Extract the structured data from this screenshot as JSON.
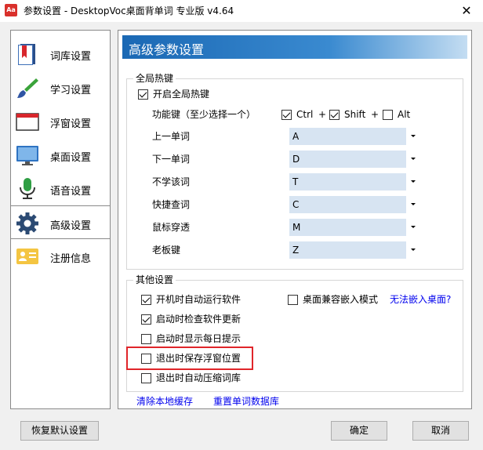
{
  "window": {
    "app_icon_text": "Aa",
    "title": "参数设置 - DesktopVoc桌面背单词 专业版 v4.64",
    "close_glyph": "✕"
  },
  "sidebar": {
    "items": [
      {
        "label": "词库设置",
        "icon": "book-icon"
      },
      {
        "label": "学习设置",
        "icon": "brush-icon"
      },
      {
        "label": "浮窗设置",
        "icon": "window-icon"
      },
      {
        "label": "桌面设置",
        "icon": "monitor-icon"
      },
      {
        "label": "语音设置",
        "icon": "microphone-icon"
      },
      {
        "label": "高级设置",
        "icon": "gear-icon"
      },
      {
        "label": "注册信息",
        "icon": "id-card-icon"
      }
    ],
    "active": "高级设置"
  },
  "main": {
    "title": "高级参数设置",
    "hotkeys": {
      "group_title": "全局热键",
      "enable_label": "开启全局热键",
      "enable_checked": true,
      "modifier_label": "功能键（至少选择一个）",
      "modifiers": [
        {
          "label": "Ctrl",
          "checked": true
        },
        {
          "label": "Shift",
          "checked": true
        },
        {
          "label": "Alt",
          "checked": false
        }
      ],
      "plus": "+",
      "rows": [
        {
          "label": "上一单词",
          "value": "A"
        },
        {
          "label": "下一单词",
          "value": "D"
        },
        {
          "label": "不学该词",
          "value": "T"
        },
        {
          "label": "快捷查词",
          "value": "C"
        },
        {
          "label": "鼠标穿透",
          "value": "M"
        },
        {
          "label": "老板键",
          "value": "Z"
        }
      ]
    },
    "other": {
      "group_title": "其他设置",
      "options": [
        {
          "label": "开机时自动运行软件",
          "checked": true
        },
        {
          "label": "启动时检查软件更新",
          "checked": true
        },
        {
          "label": "启动时显示每日提示",
          "checked": false
        },
        {
          "label": "退出时保存浮窗位置",
          "checked": false
        },
        {
          "label": "退出时自动压缩词库",
          "checked": false
        }
      ],
      "compat_label": "桌面兼容嵌入模式",
      "compat_checked": false,
      "compat_link": "无法嵌入桌面?"
    },
    "links": {
      "clear_cache": "清除本地缓存",
      "reset_db": "重置单词数据库"
    }
  },
  "footer": {
    "restore_label": "恢复默认设置",
    "ok_label": "确定",
    "cancel_label": "取消"
  },
  "colors": {
    "header_blue": "#1a68b4",
    "combo_bg": "#d7e4f2",
    "link": "#0000ee",
    "highlight_red": "#e0252a"
  }
}
